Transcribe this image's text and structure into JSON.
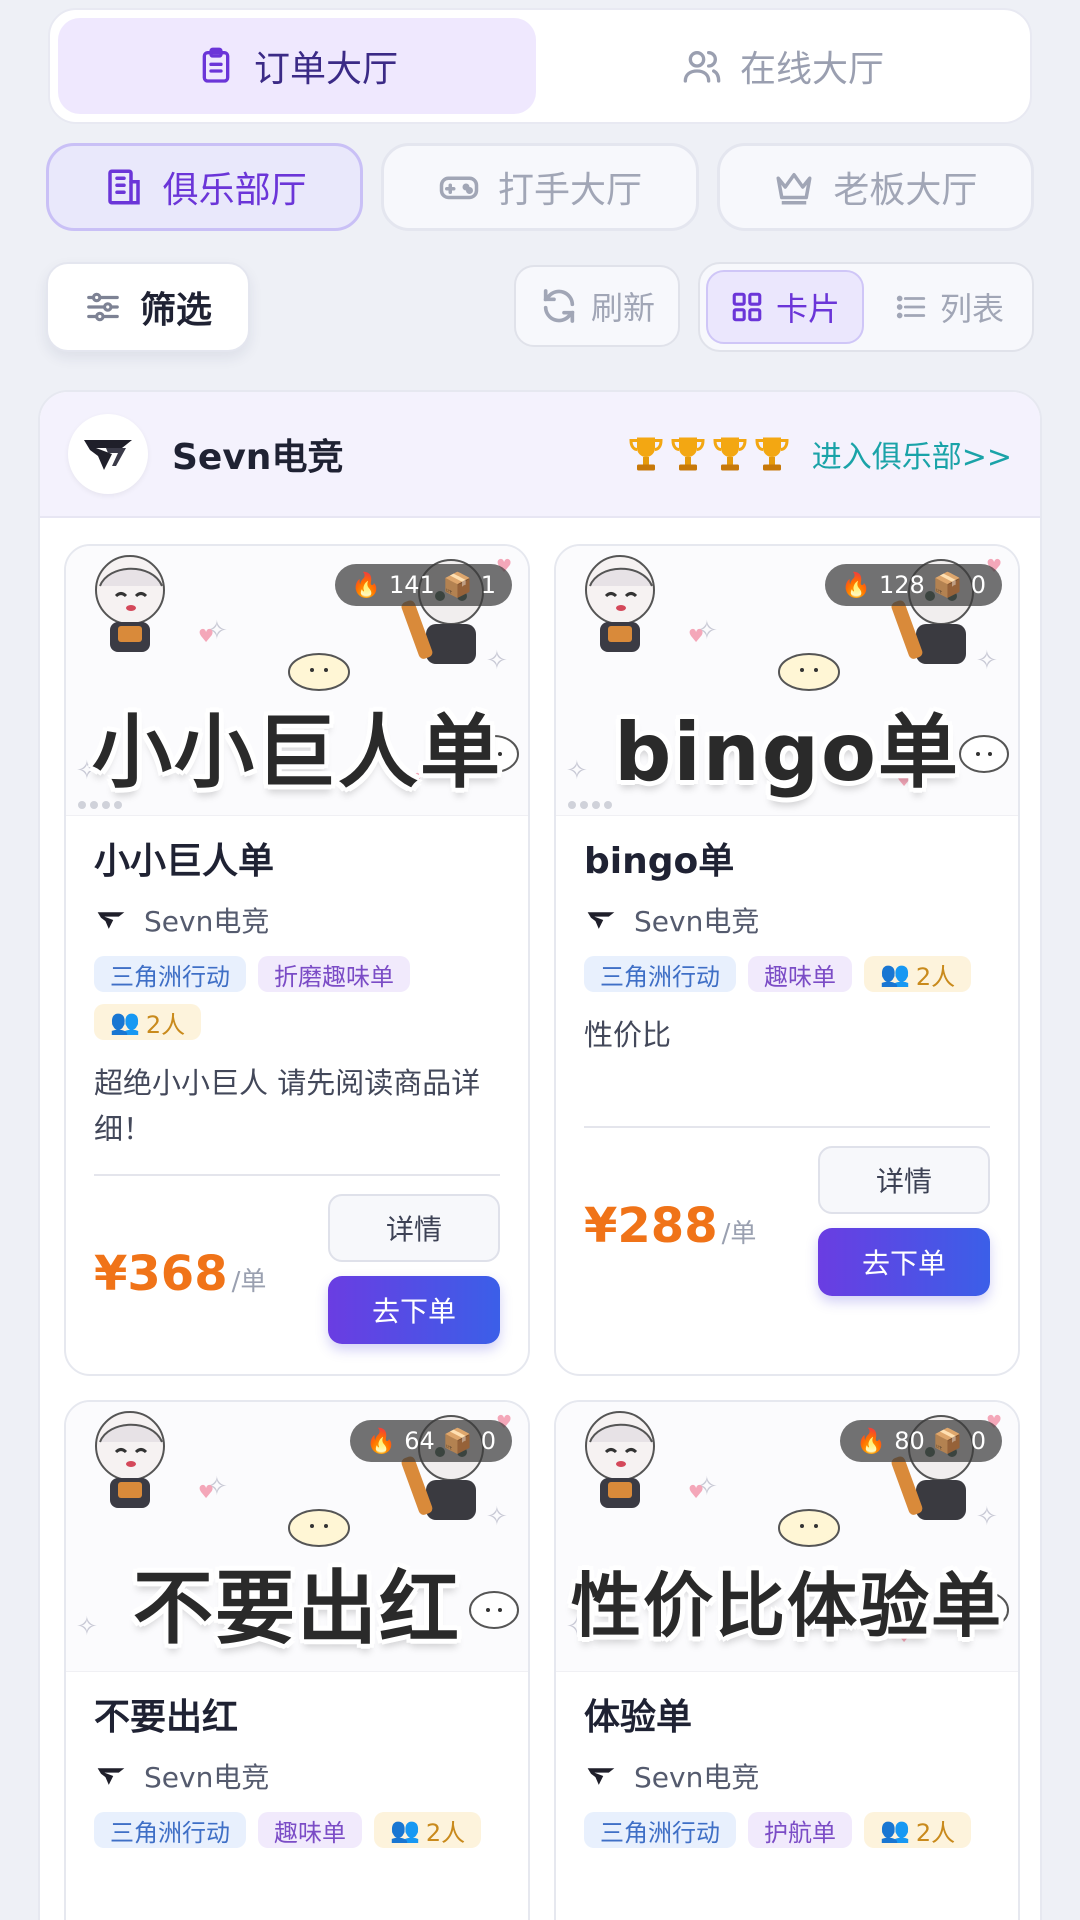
{
  "top_tabs": [
    {
      "label": "订单大厅",
      "icon": "clipboard-icon",
      "active": true
    },
    {
      "label": "在线大厅",
      "icon": "users-icon",
      "active": false
    }
  ],
  "halls": [
    {
      "label": "俱乐部厅",
      "icon": "building-icon",
      "active": true
    },
    {
      "label": "打手大厅",
      "icon": "gamepad-icon",
      "active": false
    },
    {
      "label": "老板大厅",
      "icon": "crown-icon",
      "active": false
    }
  ],
  "toolbar": {
    "filter_label": "筛选",
    "refresh_label": "刷新",
    "view_card_label": "卡片",
    "view_list_label": "列表",
    "active_view": "card"
  },
  "club": {
    "name": "Sevn电竞",
    "trophy_count": 4,
    "enter_label": "进入俱乐部>>"
  },
  "cards": [
    {
      "banner_text": "小小巨人单",
      "hot": "141",
      "box": "1",
      "title": "小小巨人单",
      "club": "Sevn电竞",
      "tags": [
        {
          "text": "三角洲行动",
          "color": "blue"
        },
        {
          "text": "折磨趣味单",
          "color": "purple"
        }
      ],
      "people": "2人",
      "description": "超绝小小巨人 请先阅读商品详细！",
      "price": "¥368",
      "unit": "/单",
      "detail_label": "详情",
      "order_label": "去下单"
    },
    {
      "banner_text": "bingo单",
      "hot": "128",
      "box": "0",
      "title": "bingo单",
      "club": "Sevn电竞",
      "tags": [
        {
          "text": "三角洲行动",
          "color": "blue"
        },
        {
          "text": "趣味单",
          "color": "purple"
        }
      ],
      "people": "2人",
      "description": "性价比",
      "price": "¥288",
      "unit": "/单",
      "detail_label": "详情",
      "order_label": "去下单"
    },
    {
      "banner_text": "不要出红",
      "hot": "64",
      "box": "0",
      "title": "不要出红",
      "club": "Sevn电竞",
      "tags": [
        {
          "text": "三角洲行动",
          "color": "blue"
        },
        {
          "text": "趣味单",
          "color": "purple"
        }
      ],
      "people": "2人",
      "description": "",
      "price": "",
      "unit": "",
      "detail_label": "",
      "order_label": ""
    },
    {
      "banner_text": "性价比体验单",
      "hot": "80",
      "box": "0",
      "title": "体验单",
      "club": "Sevn电竞",
      "tags": [
        {
          "text": "三角洲行动",
          "color": "blue"
        },
        {
          "text": "护航单",
          "color": "purple"
        }
      ],
      "people": "2人",
      "description": "",
      "price": "",
      "unit": "",
      "detail_label": "",
      "order_label": ""
    }
  ],
  "colors": {
    "accent_purple": "#6b35d8",
    "price_orange": "#f07318",
    "enter_teal": "#1aa3a8",
    "order_gradient_start": "#6a3de2",
    "order_gradient_end": "#3b5fe8"
  }
}
